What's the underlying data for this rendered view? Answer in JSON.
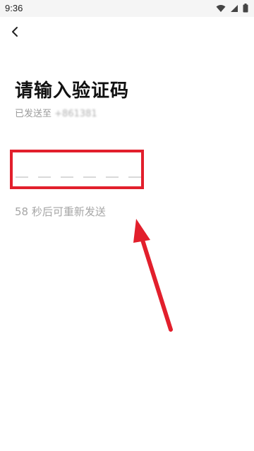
{
  "status_bar": {
    "time": "9:36",
    "icons": [
      "wifi-icon",
      "signal-icon",
      "battery-icon"
    ]
  },
  "header": {
    "back_icon": "chevron-left-icon"
  },
  "main": {
    "title": "请输入验证码",
    "sent_prefix": "已发送至",
    "sent_number_masked": "+861381",
    "code_length": 6,
    "resend_text": "58 秒后可重新发送"
  },
  "annotation": {
    "highlight_color": "#e21f2c"
  }
}
